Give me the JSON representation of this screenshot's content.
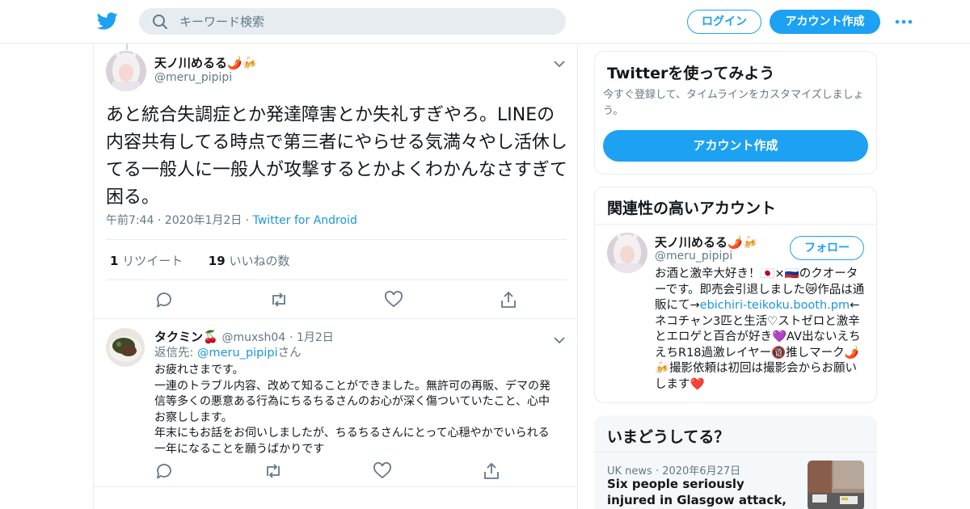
{
  "search": {
    "placeholder": "キーワード検索"
  },
  "header": {
    "login_label": "ログイン",
    "signup_label": "アカウント作成"
  },
  "tweet": {
    "author_name": "天ノ川めるる🌶️🍻",
    "author_handle": "@meru_pipipi",
    "text": "あと統合失調症とか発達障害とか失礼すぎやろ。LINEの内容共有してる時点で第三者にやらせる気満々やし活休してる一般人に一般人が攻撃するとかよくわかんなさすぎて困る。",
    "time": "午前7:44",
    "date": "2020年1月2日",
    "source": "Twitter for Android",
    "retweet_count": "1",
    "retweet_label": "リツイート",
    "like_count": "19",
    "like_label": "いいねの数"
  },
  "reply": {
    "author_name": "タクミン🍒",
    "author_handle": "@muxsh04",
    "date": "1月2日",
    "replying_prefix": "返信先: ",
    "replying_handle": "@meru_pipipi",
    "replying_suffix": "さん",
    "lines": [
      "お疲れさまです。",
      "一連のトラブル内容、改めて知ることができました。無許可の再販、デマの発信等多くの悪意ある行為にちるちるさんのお心が深く傷ついていたこと、心中お察しします。",
      "年末にもお話をお伺いしましたが、ちるちるさんにとって心穏やかでいられる一年になることを願うばかりです"
    ]
  },
  "signup_card": {
    "title": "Twitterを使ってみよう",
    "description": "今すぐ登録して、タイムラインをカスタマイズしましょう。",
    "button": "アカウント作成"
  },
  "related_card": {
    "title": "関連性の高いアカウント",
    "name": "天ノ川めるる🌶️🍻",
    "handle": "@meru_pipipi",
    "follow": "フォロー",
    "bio_1": "お酒と激辛大好き！🇯🇵×🇷🇺のクオーターです。即売会引退しました😿作品は通販にて→",
    "bio_link": "ebichiri-teikoku.booth.pm",
    "bio_2": "←ネコチャン3匹と生活♡ストゼロと激辛とエロゲと百合が好き💜AV出ないえちえちR18過激レイヤー🔞推しマーク🌶️🍻撮影依頼は初回は撮影会からお願いします❤️"
  },
  "trends_card": {
    "title": "いまどうしてる？",
    "source": "UK news",
    "date": "2020年6月27日",
    "headline": "Six people seriously injured in Glasgow attack, including two"
  },
  "colors": {
    "accent": "#1da1f2",
    "link": "#1b95e0",
    "muted": "#657786",
    "border": "#e6ecf0"
  }
}
